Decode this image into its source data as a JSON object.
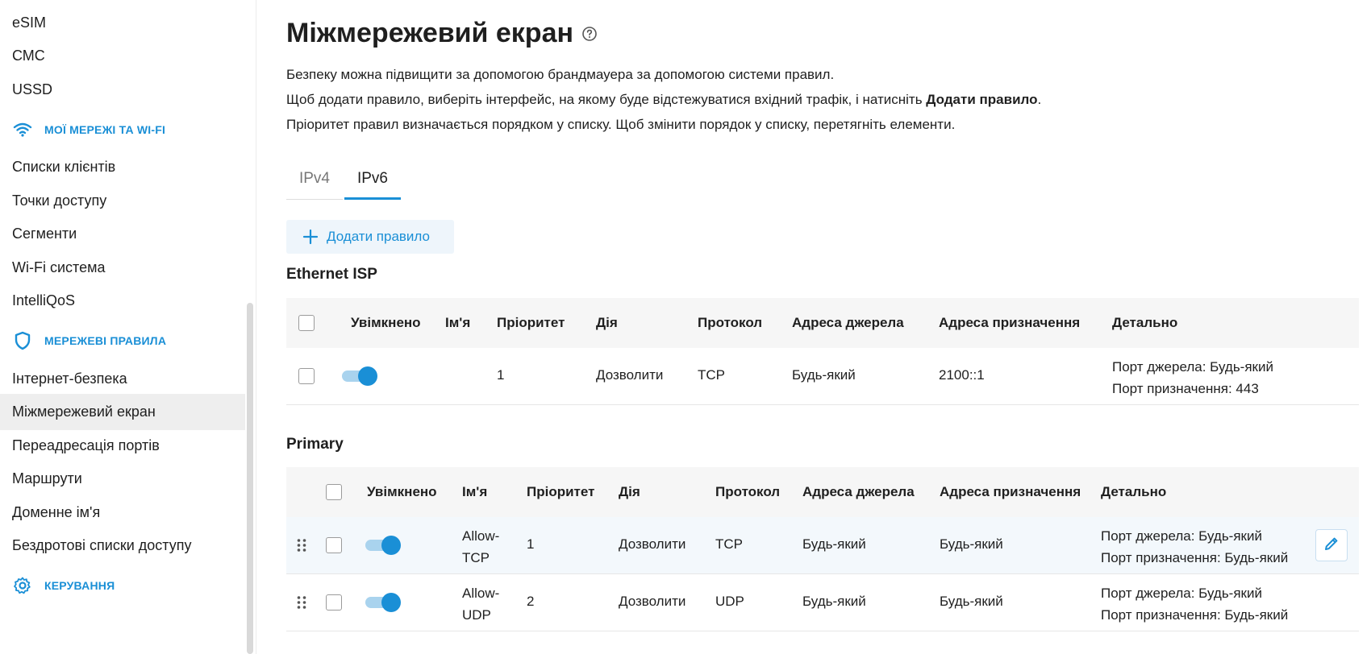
{
  "sidebar": {
    "items_top": [
      {
        "label": "eSIM"
      },
      {
        "label": "СМС"
      },
      {
        "label": "USSD"
      }
    ],
    "section_networks": {
      "label": "МОЇ МЕРЕЖІ ТА WI-FI",
      "icon": "wifi-icon"
    },
    "networks_items": [
      {
        "label": "Списки клієнтів"
      },
      {
        "label": "Точки доступу"
      },
      {
        "label": "Сегменти"
      },
      {
        "label": "Wi-Fi система"
      },
      {
        "label": "IntelliQoS"
      }
    ],
    "section_rules": {
      "label": "МЕРЕЖЕВІ ПРАВИЛА",
      "icon": "shield-icon"
    },
    "rules_items": [
      {
        "label": "Інтернет-безпека"
      },
      {
        "label": "Міжмережевий екран",
        "active": true
      },
      {
        "label": "Переадресація портів"
      },
      {
        "label": "Маршрути"
      },
      {
        "label": "Доменне ім'я"
      },
      {
        "label": "Бездротові списки доступу"
      }
    ],
    "section_management": {
      "label": "КЕРУВАННЯ",
      "icon": "gear-icon"
    }
  },
  "page": {
    "title": "Міжмережевий екран",
    "desc_line1": "Безпеку можна підвищити за допомогою брандмауера за допомогою системи правил.",
    "desc_line2_pre": "Щоб додати правило, виберіть інтерфейс, на якому буде відстежуватися вхідний трафік, і натисніть ",
    "desc_line2_bold": "Додати правило",
    "desc_line2_post": ".",
    "desc_line3": "Пріоритет правил визначається порядком у списку. Щоб змінити порядок у списку, перетягніть елементи."
  },
  "tabs": [
    {
      "label": "IPv4",
      "active": false
    },
    {
      "label": "IPv6",
      "active": true
    }
  ],
  "add_rule_label": "Додати правило",
  "columns": {
    "enabled": "Увімкнено",
    "name": "Ім'я",
    "priority": "Пріоритет",
    "action": "Дія",
    "protocol": "Протокол",
    "source": "Адреса джерела",
    "destination": "Адреса призначення",
    "details": "Детально"
  },
  "groups": [
    {
      "title": "Ethernet ISP",
      "rows": [
        {
          "enabled": true,
          "name": "",
          "priority": "1",
          "action": "Дозволити",
          "protocol": "TCP",
          "source": "Будь-який",
          "destination": "2100::1",
          "details1": "Порт джерела: Будь-який",
          "details2": "Порт призначення: 443"
        }
      ]
    },
    {
      "title": "Primary",
      "rows": [
        {
          "enabled": true,
          "name1": "Allow-",
          "name2": "TCP",
          "priority": "1",
          "action": "Дозволити",
          "protocol": "TCP",
          "source": "Будь-який",
          "destination": "Будь-який",
          "details1": "Порт джерела: Будь-який",
          "details2": "Порт призначення: Будь-який"
        },
        {
          "enabled": true,
          "name1": "Allow-",
          "name2": "UDP",
          "priority": "2",
          "action": "Дозволити",
          "protocol": "UDP",
          "source": "Будь-який",
          "destination": "Будь-який",
          "details1": "Порт джерела: Будь-який",
          "details2": "Порт призначення: Будь-який"
        }
      ]
    }
  ],
  "colors": {
    "accent": "#1a8fd6",
    "active_bg": "#eeeeee",
    "header_bg": "#f6f6f6",
    "highlight_row": "#f3f8fc"
  }
}
